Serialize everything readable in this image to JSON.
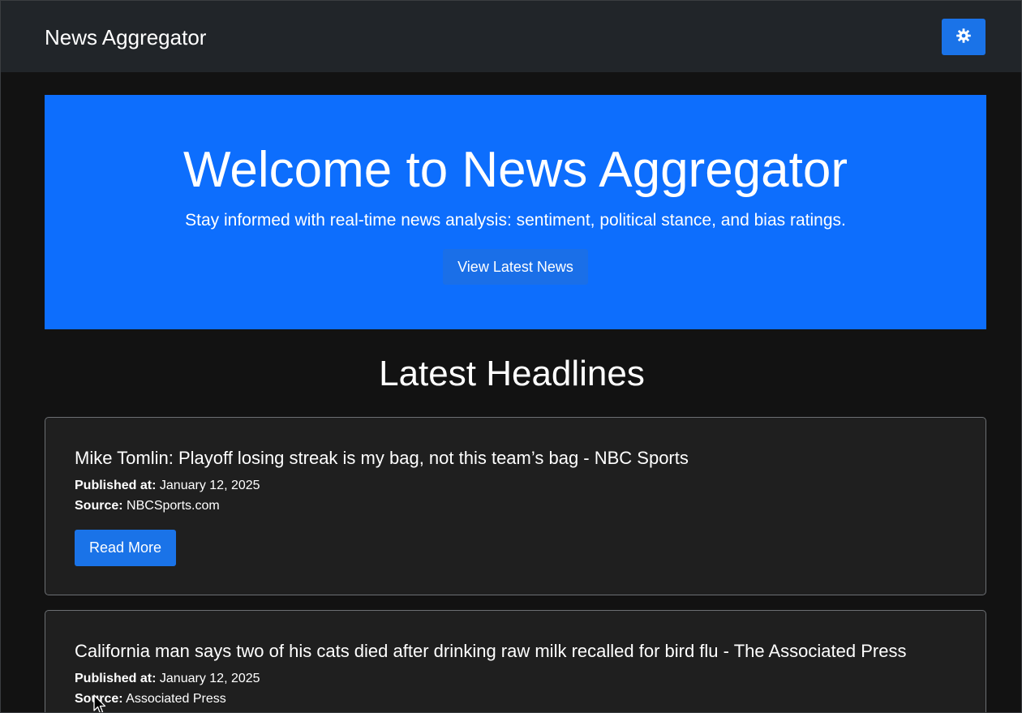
{
  "navbar": {
    "brand": "News Aggregator",
    "theme_toggle_icon": "gear-icon"
  },
  "hero": {
    "title": "Welcome to News Aggregator",
    "subtitle": "Stay informed with real-time news analysis: sentiment, political stance, and bias ratings.",
    "button_label": "View Latest News"
  },
  "headlines": {
    "title": "Latest Headlines",
    "published_label": "Published at:",
    "source_label": "Source:",
    "read_more_label": "Read More",
    "articles": [
      {
        "title": "Mike Tomlin: Playoff losing streak is my bag, not this team’s bag - NBC Sports",
        "published_at": "January 12, 2025",
        "source": "NBCSports.com"
      },
      {
        "title": "California man says two of his cats died after drinking raw milk recalled for bird flu - The Associated Press",
        "published_at": "January 12, 2025",
        "source": "Associated Press"
      }
    ]
  },
  "colors": {
    "page_bg": "#121212",
    "navbar_bg": "#212529",
    "primary": "#0d6efd",
    "button": "#1a73e8",
    "card_bg": "#1f1f1f",
    "card_border": "#6c6f73"
  }
}
